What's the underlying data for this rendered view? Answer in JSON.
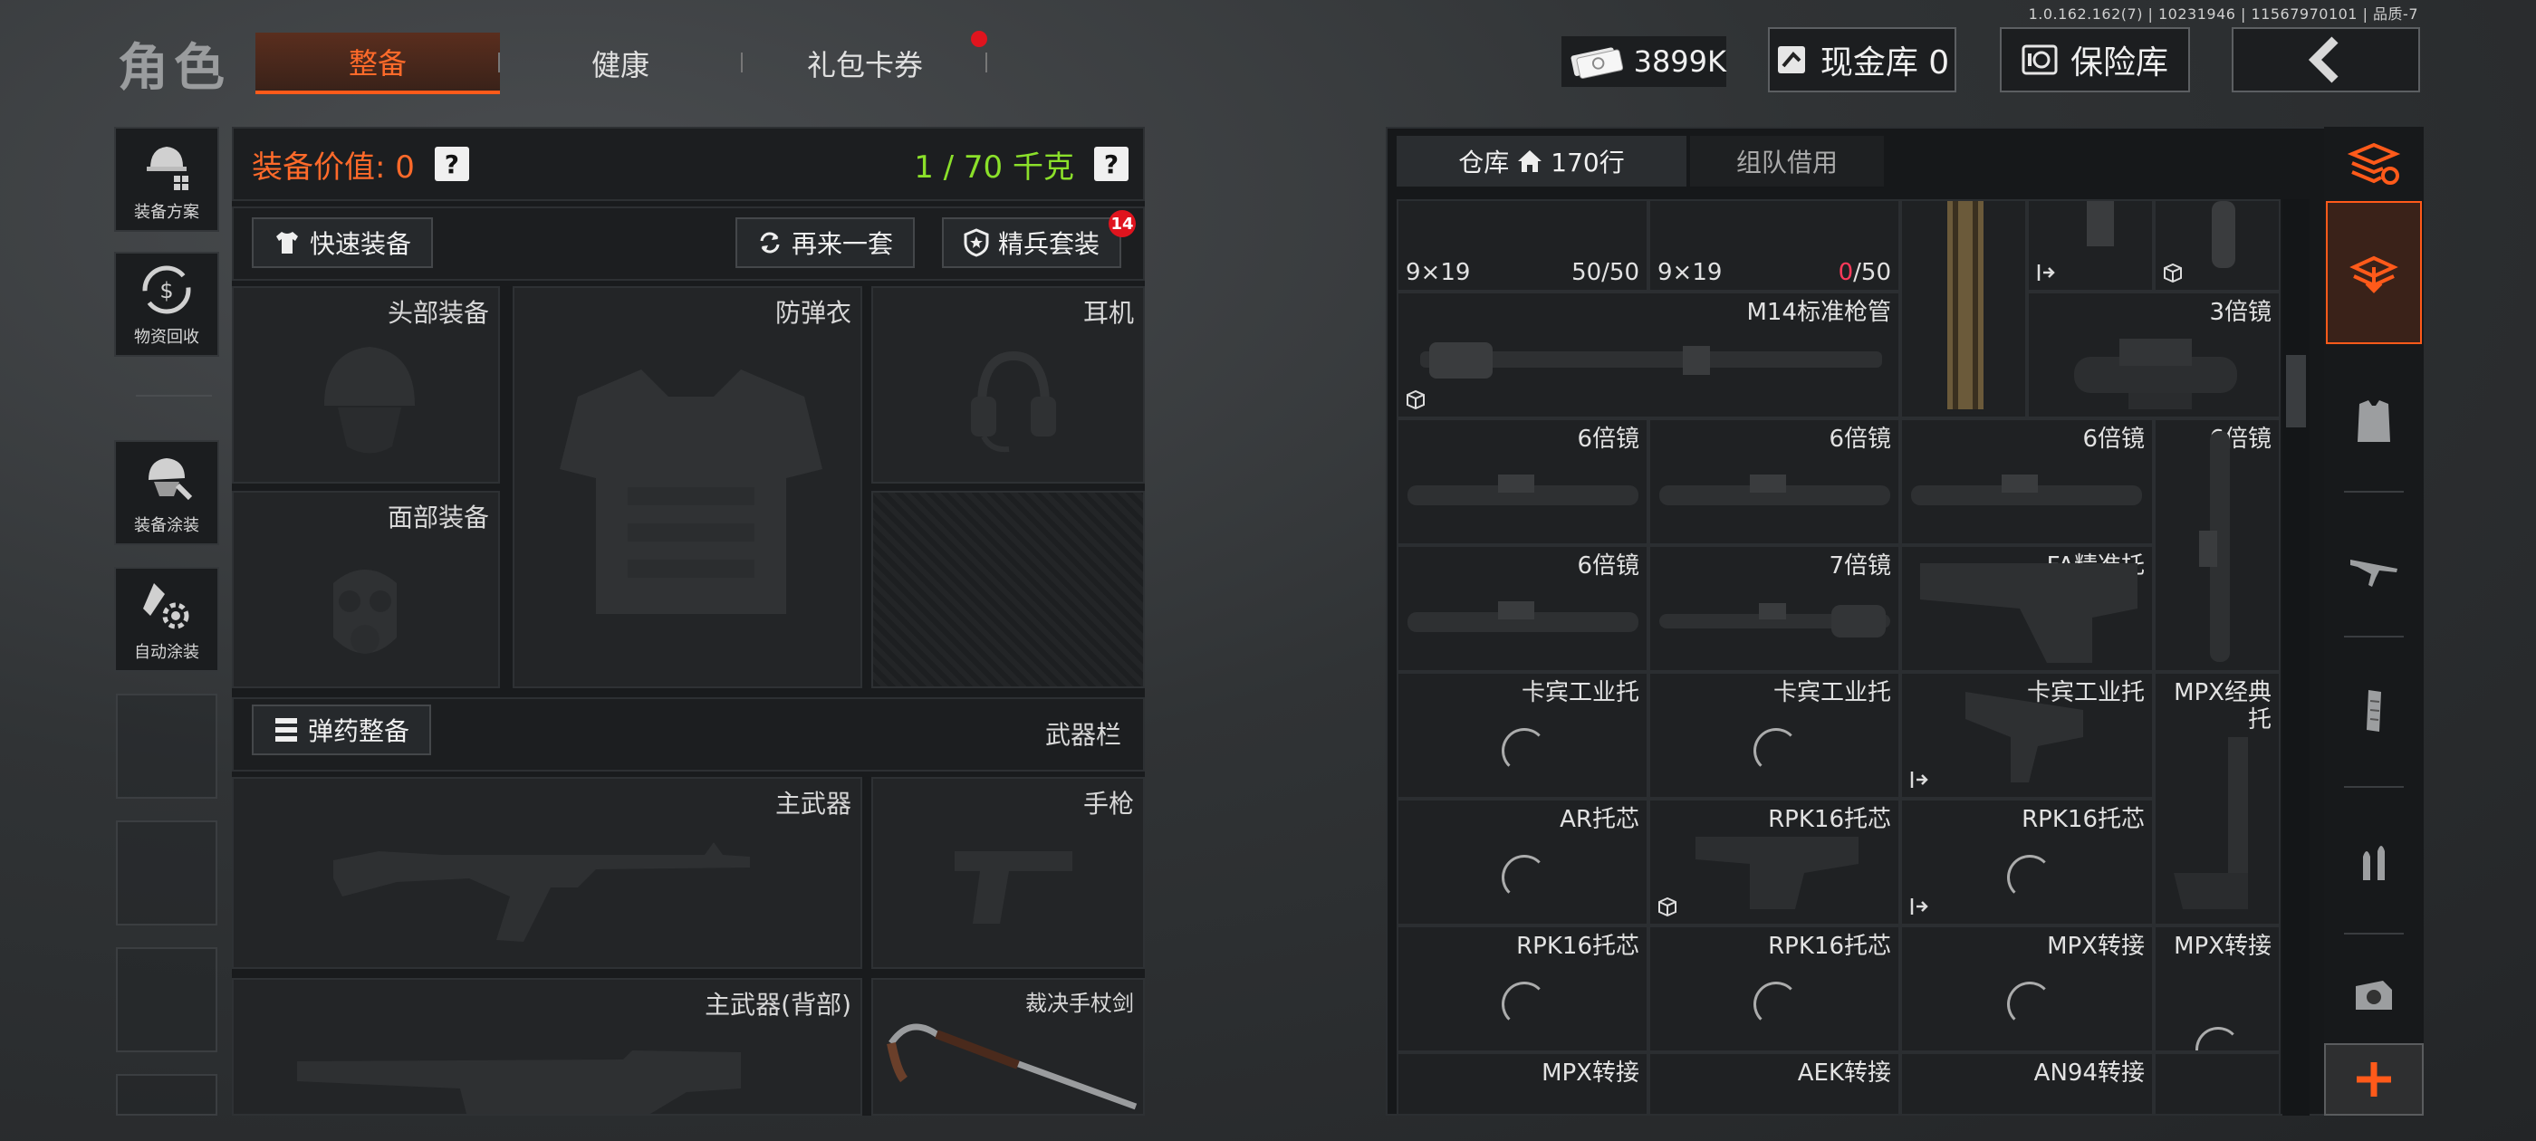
{
  "version": "1.0.162.162(7) | 10231946 | 11567970101 | 品质-7",
  "title": "角色",
  "tabs": [
    {
      "label": "整备",
      "active": true
    },
    {
      "label": "健康",
      "active": false
    },
    {
      "label": "礼包卡券",
      "active": false,
      "has_dot": true
    }
  ],
  "hud": {
    "money": "3899K",
    "cash_vault": "现金库 0",
    "safe": "保险库",
    "back_icon": "chevron-left-icon"
  },
  "sidebar": [
    {
      "label": "装备方案",
      "icon": "loadout-icon"
    },
    {
      "label": "物资回收",
      "icon": "recycle-icon"
    },
    {
      "label": "装备涂装",
      "icon": "paint-helmet-icon"
    },
    {
      "label": "自动涂装",
      "icon": "auto-paint-icon"
    }
  ],
  "equip": {
    "value_label": "装备价值: 0",
    "weight_label": "1 / 70 千克",
    "quick_equip": "快速装备",
    "again": "再来一套",
    "elite": "精兵套装",
    "elite_badge": "14",
    "ammo_equip": "弹药整备",
    "weapon_bar": "武器栏",
    "slots": {
      "head": "头部装备",
      "armor": "防弹衣",
      "ear": "耳机",
      "face": "面部装备",
      "primary": "主武器",
      "pistol": "手枪",
      "primary_back": "主武器(背部)",
      "melee": "裁决手杖剑"
    }
  },
  "inventory": {
    "tab_vault": "仓库",
    "vault_rows": "170行",
    "tab_team": "组队借用",
    "ammo": [
      {
        "caliber": "9×19",
        "count": "50",
        "max": "/50"
      },
      {
        "caliber": "9×19",
        "count": "0",
        "max": "/50"
      }
    ],
    "items": {
      "barrel": "M14标准枪管",
      "scope3x": "3倍镜",
      "scope6_a": "6倍镜",
      "scope6_b": "6倍镜",
      "scope6_c": "6倍镜",
      "scope6_d": "6倍镜",
      "scope6_e": "6倍镜",
      "scope7": "7倍镜",
      "fa_stock": "FA精准托",
      "kabin1": "卡宾工业托",
      "kabin2": "卡宾工业托",
      "kabin3": "卡宾工业托",
      "mpx_stock": "MPX经典托",
      "ar_core": "AR托芯",
      "rpk1": "RPK16托芯",
      "rpk2": "RPK16托芯",
      "rpk3": "RPK16托芯",
      "rpk4": "RPK16托芯",
      "mpx_a1": "MPX转接",
      "mpx_a2": "MPX转接",
      "mpx_a3": "MPX转接",
      "aek": "AEK转接",
      "an94": "AN94转接"
    }
  },
  "rightbar": [
    "filter-stack-icon",
    "layers-active-icon",
    "armor-vest-icon",
    "rifle-icon",
    "magazine-icon",
    "bullets-icon",
    "sight-icon",
    "plus-icon"
  ],
  "colors": {
    "accent_orange": "#ff5a1a",
    "value_orange": "#ff6a2a",
    "weight_green": "#8be02a",
    "alert_red": "#e0141e"
  }
}
